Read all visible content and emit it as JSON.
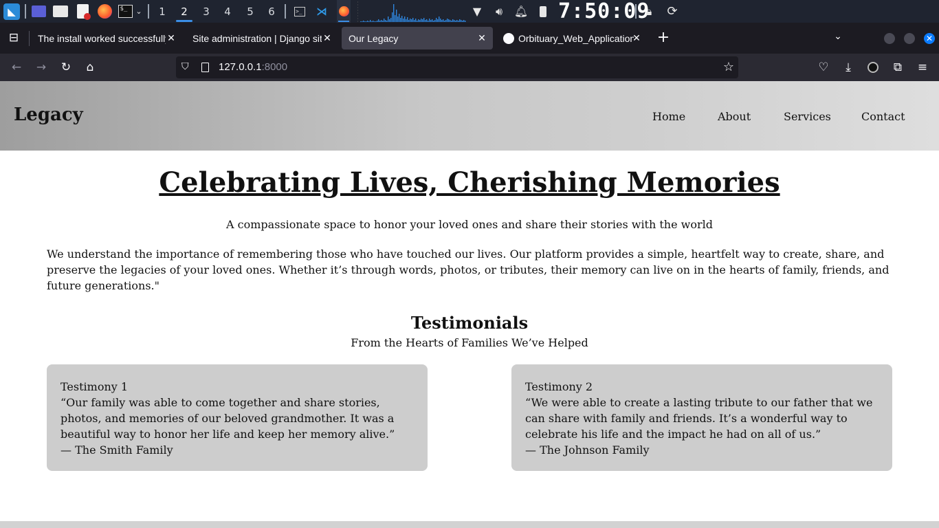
{
  "panel": {
    "workspaces": [
      "1",
      "2",
      "3",
      "4",
      "5",
      "6"
    ],
    "active_workspace": "2",
    "clock": "7:50:09",
    "accent": "#3b8ee6"
  },
  "browser": {
    "tabs": [
      {
        "label": "The install worked successfully! Congratulations!",
        "active": false
      },
      {
        "label": "Site administration | Django site admin",
        "active": false
      },
      {
        "label": "Our Legacy",
        "active": true
      },
      {
        "label": "Orbituary_Web_Application",
        "active": false
      }
    ],
    "url": {
      "host": "127.0.0.1",
      "port": ":8000"
    }
  },
  "site": {
    "logo": "Legacy",
    "nav": [
      "Home",
      "About",
      "Services",
      "Contact"
    ],
    "hero": {
      "title": "Celebrating Lives, Cherishing Memories",
      "subtitle": "A compassionate space to honor your loved ones and share their stories with the world",
      "intro": "We understand the importance of remembering those who have touched our lives. Our platform provides a simple, heartfelt way to create, share, and preserve the legacies of your loved ones. Whether it’s through words, photos, or tributes, their memory can live on in the hearts of family, friends, and future generations.\""
    },
    "testimonials": {
      "title": "Testimonials",
      "subtitle": "From the Hearts of Families We’ve Helped",
      "items": [
        {
          "heading": "Testimony 1",
          "quote": "“Our family was able to come together and share stories, photos, and memories of our beloved grandmother. It was a beautiful way to honor her life and keep her memory alive.”",
          "author": "— The Smith Family"
        },
        {
          "heading": "Testimony 2",
          "quote": "“We were able to create a lasting tribute to our father that we can share with family and friends. It’s a wonderful way to celebrate his life and the impact he had on all of us.”",
          "author": "— The Johnson Family"
        }
      ]
    }
  }
}
